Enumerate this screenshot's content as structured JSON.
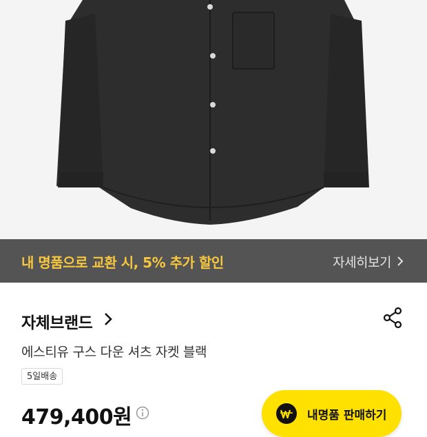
{
  "promo": {
    "text": "내 명품으로 교환 시, 5% 추가 할인",
    "link_label": "자세히보기"
  },
  "product": {
    "brand": "자체브랜드",
    "title": "에스티유 구스 다운 셔츠 자켓 블랙",
    "delivery_badge": "5일배송",
    "price": "479,400원"
  },
  "sell_button": {
    "label": "내명품 판매하기",
    "icon": "won-icon"
  },
  "colors": {
    "promo_bg": "#545454",
    "promo_text": "#f7c83f",
    "sell_button_bg": "#ffe100",
    "hero_bg": "#f4f4f4"
  }
}
